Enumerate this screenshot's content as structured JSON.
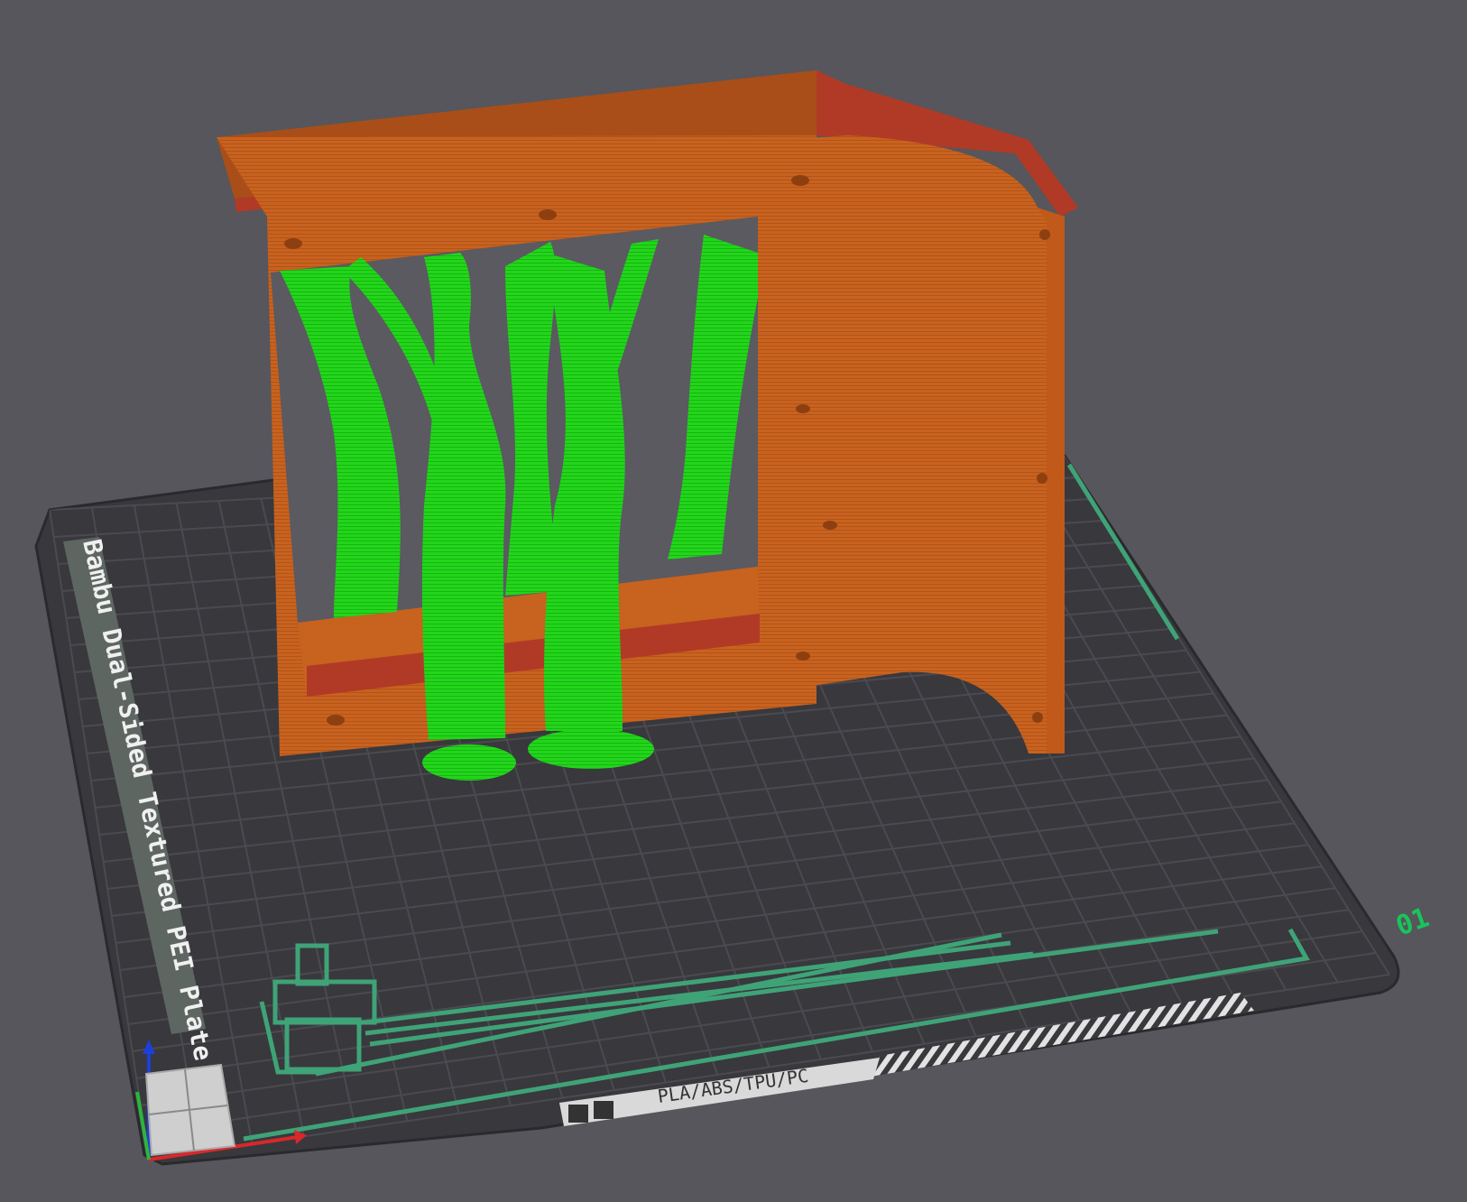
{
  "viewport": {
    "plate_label": "Bambu Dual-Sided Textured PEI Plate",
    "plate_number": "01",
    "filament_label": "PLA/ABS/TPU/PC"
  },
  "colors": {
    "background": "#56565c",
    "plate": "#38383d",
    "grid": "#4a4a50",
    "model_orange": "#c8621f",
    "model_red": "#b13a26",
    "support_green": "#22d61a",
    "guide_green": "#3fa377",
    "axis_x": "#d8282b",
    "axis_y": "#2cb53c",
    "axis_z": "#1e3fd8"
  },
  "icons": [
    "view-cube-icon",
    "axis-gizmo-icon"
  ]
}
